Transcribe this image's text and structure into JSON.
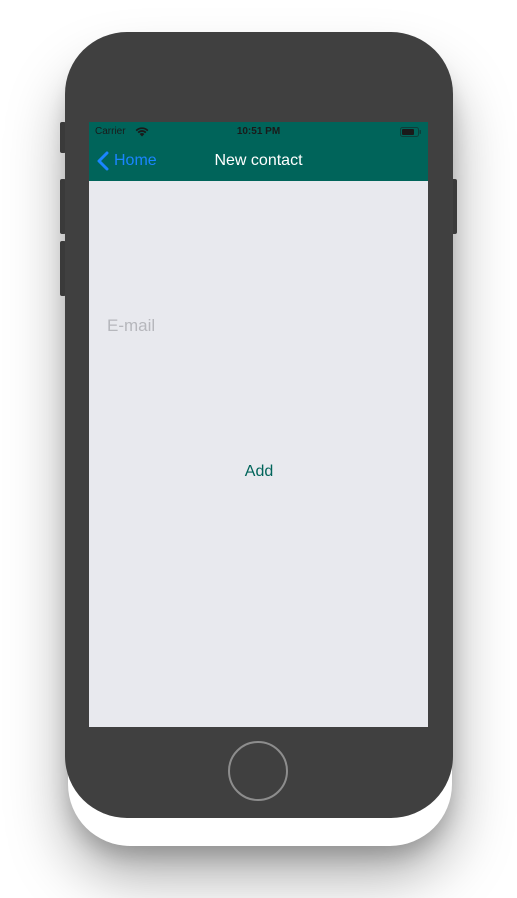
{
  "status_bar": {
    "carrier": "Carrier",
    "time": "10:51 PM",
    "wifi_icon": "wifi-icon",
    "battery_icon": "battery-icon"
  },
  "nav_bar": {
    "back_label": "Home",
    "back_icon": "chevron-left-icon",
    "title": "New contact"
  },
  "form": {
    "email_placeholder": "E-mail",
    "email_value": "",
    "add_label": "Add"
  },
  "colors": {
    "nav_background": "#00645a",
    "back_tint": "#1a85ff",
    "screen_background": "#e8e9ee",
    "button_text": "#00645a",
    "placeholder": "#b6b7bc"
  }
}
